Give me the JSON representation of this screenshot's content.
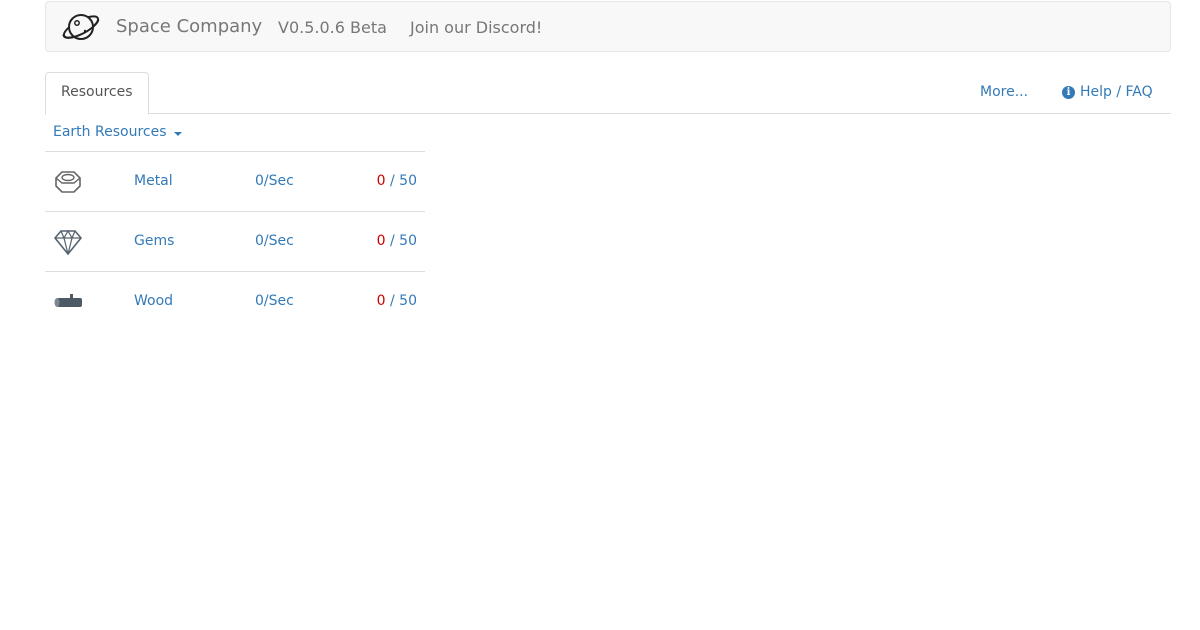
{
  "navbar": {
    "brand_name": "Space Company",
    "version": "V0.5.0.6 Beta",
    "discord_link": "Join our Discord!",
    "logo_icon": "planet-icon"
  },
  "tabs": {
    "active": "Resources",
    "more": "More...",
    "help": "Help / FAQ",
    "help_icon": "info-circle-icon"
  },
  "category": {
    "label": "Earth Resources"
  },
  "resources": [
    {
      "name": "Metal",
      "rate": "0/Sec",
      "current": "0",
      "capacity": " / 50",
      "icon": "hex-nut-icon"
    },
    {
      "name": "Gems",
      "rate": "0/Sec",
      "current": "0",
      "capacity": " / 50",
      "icon": "gem-icon"
    },
    {
      "name": "Wood",
      "rate": "0/Sec",
      "current": "0",
      "capacity": " / 50",
      "icon": "log-icon"
    }
  ],
  "colors": {
    "link": "#337ab7",
    "warning": "#cc0000",
    "navbar_bg": "#f8f8f8"
  }
}
